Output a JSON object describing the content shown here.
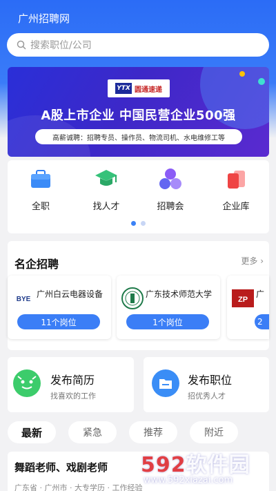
{
  "app": {
    "title": "广州招聘网"
  },
  "search": {
    "placeholder": "搜索职位/公司"
  },
  "banner": {
    "logo_mark": "YTX",
    "logo_text": "圆通速递",
    "headline": "A股上市企业  中国民营企业500强",
    "subline": "高薪诚聘：招聘专员、操作员、物流司机、水电维修工等"
  },
  "quick": [
    {
      "label": "全职",
      "icon": "briefcase-icon"
    },
    {
      "label": "找人才",
      "icon": "graduation-cap-icon"
    },
    {
      "label": "招聘会",
      "icon": "people-group-icon"
    },
    {
      "label": "企业库",
      "icon": "building-cards-icon"
    }
  ],
  "famous": {
    "title": "名企招聘",
    "more": "更多",
    "companies": [
      {
        "name": "广州白云电器设备",
        "jobs": "11个岗位",
        "logo": "BYE"
      },
      {
        "name": "广东技术师范大学",
        "jobs": "1个岗位",
        "logo": "seal"
      },
      {
        "name": "广",
        "jobs": "2",
        "logo": "ZP"
      }
    ]
  },
  "actions": [
    {
      "title": "发布简历",
      "sub": "找喜欢的工作",
      "icon": "resume-face-icon",
      "color": "#3ccc6b"
    },
    {
      "title": "发布职位",
      "sub": "招优秀人才",
      "icon": "folder-icon",
      "color": "#3a8df6"
    }
  ],
  "tabs": [
    "最新",
    "紧急",
    "推荐",
    "附近"
  ],
  "job": {
    "title": "舞蹈老师、戏剧老师",
    "meta": "广东省 · 广州市 · 大专学历 · 工作经验"
  },
  "watermark": {
    "big_num": "592",
    "big_text": "软件园",
    "url": "www.592xiazai.com"
  },
  "colors": {
    "primary": "#2b6cf6",
    "green": "#3ccc6b",
    "red": "#ef4444"
  }
}
